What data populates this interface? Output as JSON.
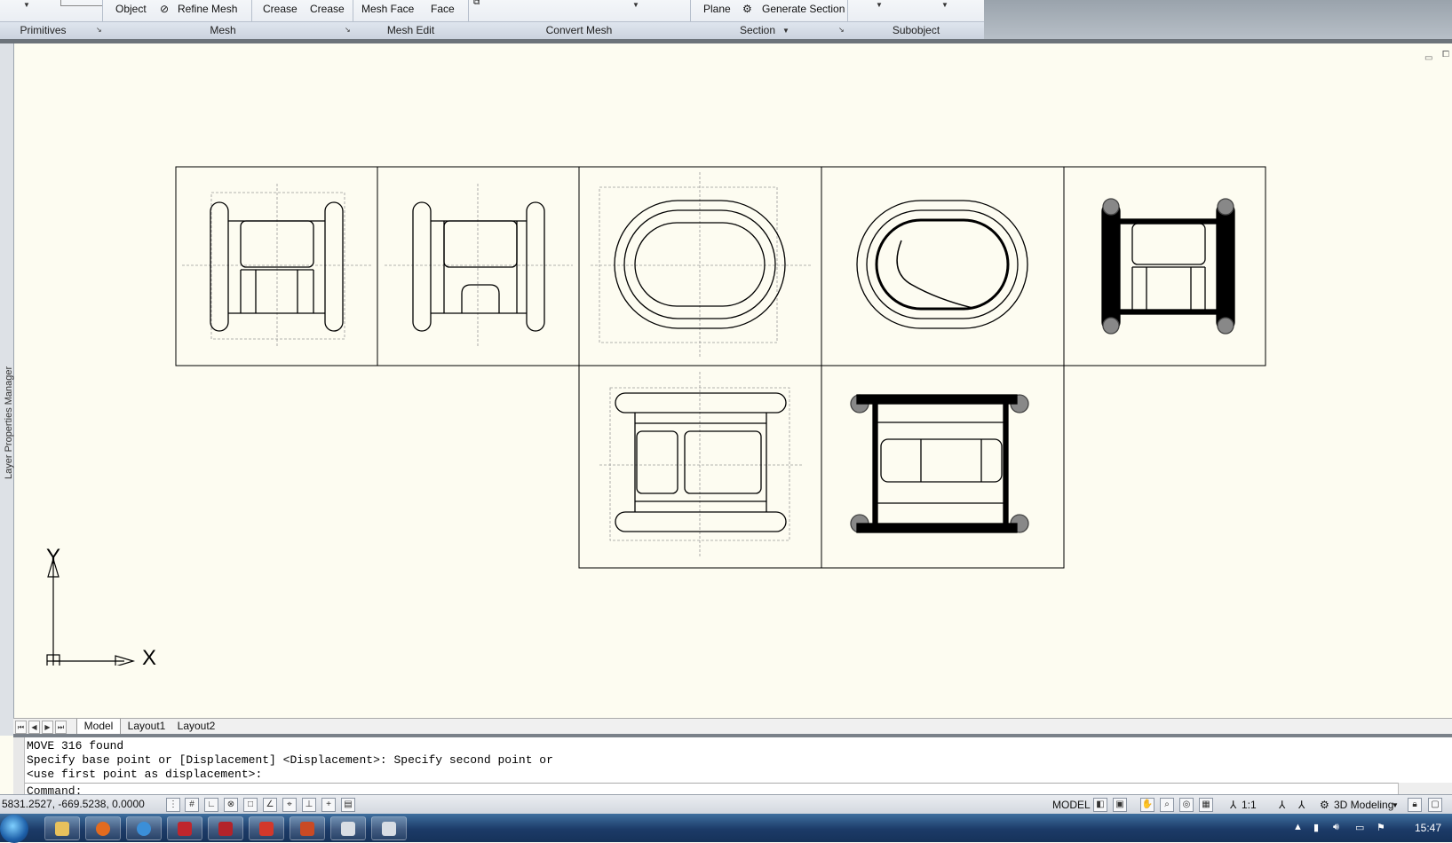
{
  "ribbon": {
    "buttons": {
      "object": "Object",
      "refine_mesh": "Refine Mesh",
      "crease_add": "Crease",
      "crease_remove": "Crease",
      "mesh_face": "Mesh Face",
      "face": "Face",
      "plane": "Plane",
      "generate_section": "Generate Section"
    },
    "groups": {
      "primitives": "Primitives",
      "mesh": "Mesh",
      "mesh_edit": "Mesh Edit",
      "convert_mesh": "Convert Mesh",
      "section": "Section",
      "subobject": "Subobject"
    }
  },
  "left_panel": {
    "label": "Layer Properties Manager"
  },
  "ucs": {
    "y_label": "Y",
    "x_label": "X"
  },
  "layout_tabs": {
    "model": "Model",
    "layout1": "Layout1",
    "layout2": "Layout2"
  },
  "command_line": {
    "line1": "MOVE 316 found",
    "line2": "Specify base point or [Displacement] <Displacement>: Specify second point or",
    "line3": "<use first point as displacement>:",
    "prompt": "Command:"
  },
  "status_bar": {
    "coordinates": "5831.2527, -669.5238, 0.0000",
    "model": "MODEL",
    "annotation_scale": "1:1",
    "workspace": "3D Modeling"
  },
  "taskbar": {
    "clock": "15:47"
  },
  "colors": {
    "canvas": "#fdfcf1",
    "linework": "#000000",
    "hidden_lines": "#9a9a9a",
    "taskbar": "#1c3b68"
  }
}
